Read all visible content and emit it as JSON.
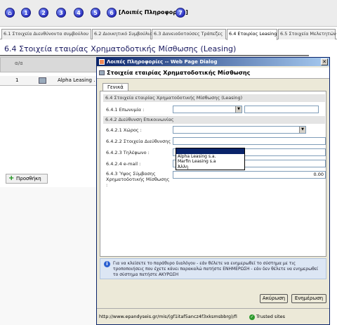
{
  "steps": [
    "1",
    "2",
    "3",
    "4",
    "5",
    "6",
    "7"
  ],
  "step_active_label": "[Λοιπές Πληροφορίες]",
  "page_tabs": [
    "6.1 Στοιχεία Διευθύνοντα συμβούλου",
    "6.2 Διοικητικό Συμβούλιο",
    "6.3 Δανειοδοτούσες Τράπεζες",
    "6.4 Εταιρίας Leasing",
    "6.5 Στοιχεία Μελετητών"
  ],
  "active_page_tab": "6.4 Εταιρίας Leasing",
  "section_title": "6.4 Στοιχεία εταιρίας Χρηματοδοτικής Μίσθωσης (Leasing)",
  "table": {
    "header_aa": "α/α",
    "rows": [
      {
        "num": "1",
        "name": "Alpha Leasing ."
      }
    ]
  },
  "add_button": "Προσθήκη",
  "dialog": {
    "title": "Λοιπές Πληροφορίες -- Web Page Dialog",
    "header": "Στοιχεία εταιρίας Χρηματοδοτικής Μίσθωσης",
    "tab": "Γενικά",
    "section1": "6.4 Στοιχεία εταιρίας Χρηματοδοτικής Μίσθωσης (Leasing)",
    "label_company": "6.4.1 Επωνυμία :",
    "section2": "6.4.2 Διεύθυνση Επικοινωνίας",
    "label_area": "6.4.2.1 Χώρος :",
    "label_address": "6.4.2.2 Στοιχεία Διεύθυνσης :",
    "label_phone": "6.4.2.3 Τηλέφωνο :",
    "label_email": "6.4.2.4 e-mail :",
    "label_amount": "6.4.3 Ύψος Σύμβασης Χρηματοδοτικής Μίσθωσης :",
    "amount_value": "0.00",
    "company_options": [
      "",
      "Alpha Leasing s.a.",
      "Marfin Leasing s.a",
      "Άλλη"
    ],
    "info_text": "Για να κλείσετε το παράθυρο διαλόγου - εάν θέλετε να ενημερωθεί το σύστημα με τις τροποποιήσεις που έχετε κάνει παρακαλώ πατήστε ΕΝΗΜΕΡΩΣΗ - εάν δεν θέλετε να ενημερωθεί το σύστημα πατήστε ΑΚΥΡΩΣΗ",
    "cancel_button": "Ακύρωση",
    "update_button": "Ενημέρωση",
    "status_url": "http://www.epandyseis.gr/mis/(gf1itaf5ancz4f3xksmsbbrg)/fi",
    "status_zone": "Trusted sites"
  }
}
